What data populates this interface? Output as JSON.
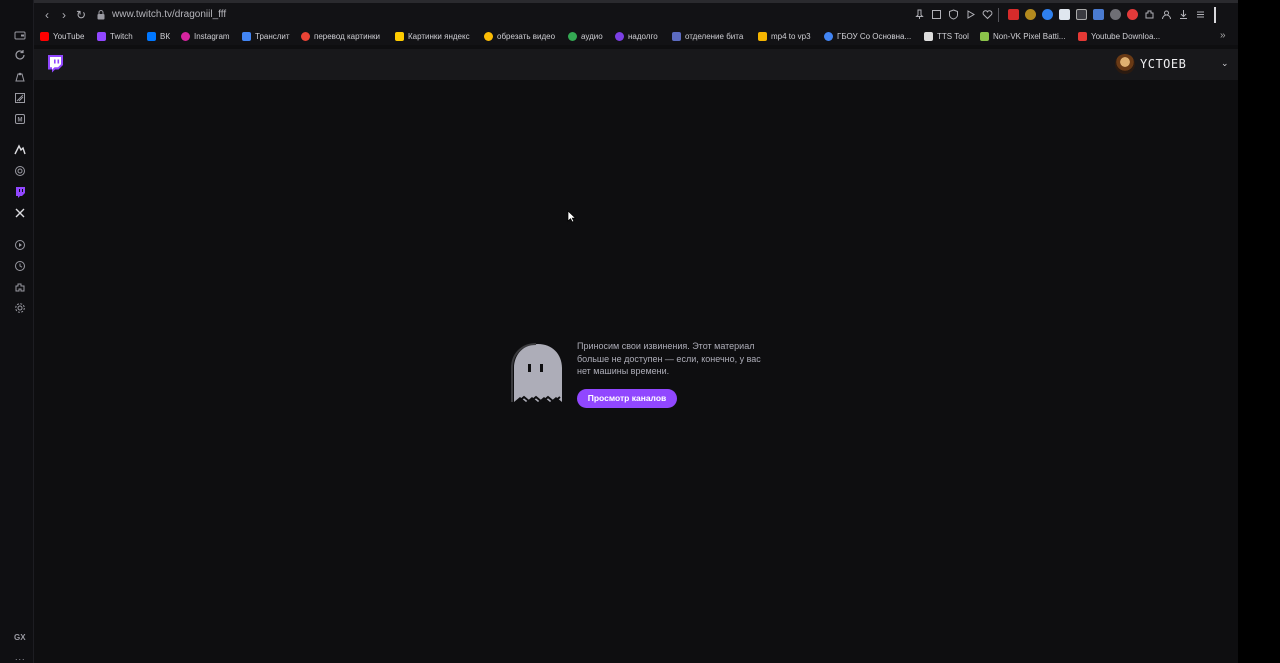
{
  "browser": {
    "url": "www.twitch.tv/dragoniil_fff",
    "bookmarks": [
      {
        "label": "YouTube",
        "color": "#ff0000"
      },
      {
        "label": "Twitch",
        "color": "#9147ff"
      },
      {
        "label": "ВК",
        "color": "#0077ff"
      },
      {
        "label": "Instagram",
        "color": "#d6249f"
      },
      {
        "label": "Транслит",
        "color": "#4285f4"
      },
      {
        "label": "перевод картинки",
        "color": "#ea4335"
      },
      {
        "label": "Картинки яндекс",
        "color": "#ffcc00"
      },
      {
        "label": "обрезать видео",
        "color": "#fbbc05"
      },
      {
        "label": "аудио",
        "color": "#34a853"
      },
      {
        "label": "надолго",
        "color": "#7b3fe4"
      },
      {
        "label": "отделение бита",
        "color": "#5c6bc0"
      },
      {
        "label": "mp4 to vp3",
        "color": "#f4b400"
      },
      {
        "label": "ГБОУ Со Основна...",
        "color": "#4285f4"
      },
      {
        "label": "TTS Tool",
        "color": "#dddddd"
      },
      {
        "label": "Non-VK Pixel Batti...",
        "color": "#8bc34a"
      },
      {
        "label": "Youtube Downloa...",
        "color": "#e53935"
      }
    ]
  },
  "twitch": {
    "username": "YCTOEB",
    "error_message": "Приносим свои извинения. Этот материал больше не доступен — если, конечно, у вас нет машины времени.",
    "browse_button": "Просмотр каналов"
  },
  "sidebar": {
    "brand": "GX",
    "more": "..."
  }
}
